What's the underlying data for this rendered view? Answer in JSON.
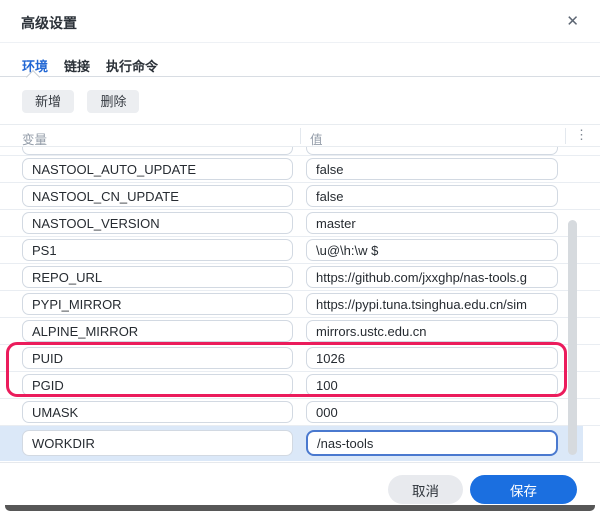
{
  "dialog": {
    "title": "高级设置",
    "close_icon": "✕"
  },
  "tabs": [
    {
      "label": "环境",
      "active": true
    },
    {
      "label": "链接",
      "active": false
    },
    {
      "label": "执行命令",
      "active": false
    }
  ],
  "toolbar": {
    "add_label": "新增",
    "delete_label": "删除"
  },
  "table": {
    "columns": {
      "name": "变量",
      "value": "值"
    },
    "menu_icon": "⋮",
    "rows": [
      {
        "name": "",
        "value": "",
        "partial": true
      },
      {
        "name": "NASTOOL_AUTO_UPDATE",
        "value": "false"
      },
      {
        "name": "NASTOOL_CN_UPDATE",
        "value": "false"
      },
      {
        "name": "NASTOOL_VERSION",
        "value": "master"
      },
      {
        "name": "PS1",
        "value": "\\u@\\h:\\w $"
      },
      {
        "name": "REPO_URL",
        "value": "https://github.com/jxxghp/nas-tools.g"
      },
      {
        "name": "PYPI_MIRROR",
        "value": "https://pypi.tuna.tsinghua.edu.cn/sim"
      },
      {
        "name": "ALPINE_MIRROR",
        "value": "mirrors.ustc.edu.cn"
      },
      {
        "name": "PUID",
        "value": "1026",
        "highlighted": true
      },
      {
        "name": "PGID",
        "value": "100",
        "highlighted": true
      },
      {
        "name": "UMASK",
        "value": "000"
      },
      {
        "name": "WORKDIR",
        "value": "/nas-tools",
        "selected": true,
        "focused_value": true
      }
    ]
  },
  "footer": {
    "cancel_label": "取消",
    "save_label": "保存"
  },
  "colors": {
    "accent_blue": "#1b6fe0",
    "active_tab_blue": "#2368d4",
    "annotation_red": "#eb1c5c",
    "selected_row_blue": "#dbe8f8",
    "focused_input_border": "#4a79cf"
  }
}
